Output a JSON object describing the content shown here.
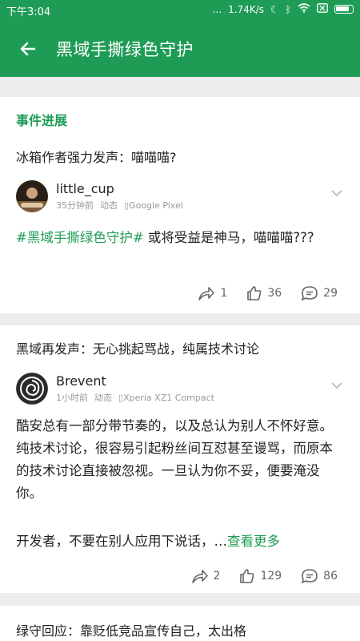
{
  "status": {
    "time": "下午3:04",
    "dots": "...",
    "speed": "1.74K/s"
  },
  "appbar": {
    "title": "黑域手撕绿色守护"
  },
  "feed": {
    "section_label": "事件进展",
    "posts": [
      {
        "headline": "冰箱作者强力发声：喵喵喵?",
        "author": "little_cup",
        "time": "35分钟前",
        "type": "动态",
        "device": "Google Pixel",
        "tag": "#黑域手撕绿色守护#",
        "text": " 或将受益是神马，喵喵喵???",
        "shares": "1",
        "likes": "36",
        "comments": "29"
      },
      {
        "headline": "黑域再发声：无心挑起骂战，纯属技术讨论",
        "author": "Brevent",
        "time": "1小时前",
        "type": "动态",
        "device": "Xperia XZ1 Compact",
        "text": "酷安总有一部分带节奏的，以及总认为别人不怀好意。纯技术讨论，很容易引起粉丝间互怼甚至谩骂，而原本的技术讨论直接被忽视。一旦认为你不妥，便要淹没你。",
        "text2": "开发者，不要在别人应用下说话，…",
        "more": "查看更多",
        "shares": "2",
        "likes": "129",
        "comments": "86"
      },
      {
        "headline": "绿守回应：靠贬低竞品宣传自己，太出格"
      }
    ]
  }
}
